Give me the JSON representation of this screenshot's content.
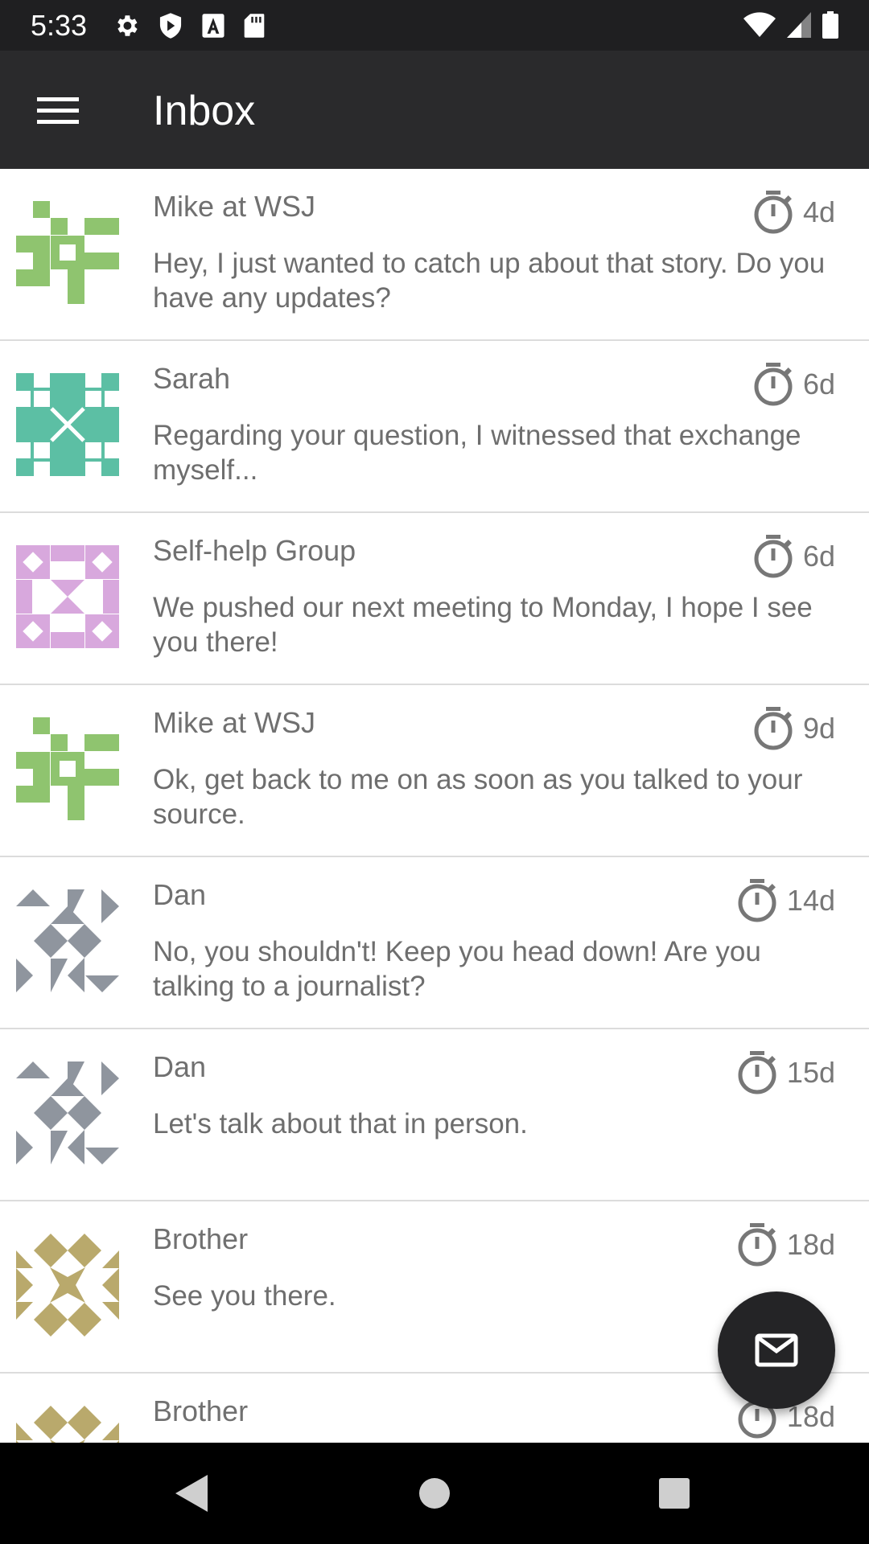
{
  "status_bar": {
    "time": "5:33",
    "left_icons": [
      "settings-icon",
      "shield-icon",
      "keyboard-a-icon",
      "sd-card-icon"
    ],
    "right_icons": [
      "wifi-icon",
      "signal-icon",
      "battery-icon"
    ]
  },
  "app_bar": {
    "title": "Inbox",
    "menu_icon": "hamburger-menu-icon"
  },
  "messages": [
    {
      "sender": "Mike at WSJ",
      "preview": "Hey, I just wanted to catch up about that story. Do you have any updates?",
      "age": "4d",
      "avatar_color": "#8fc46f"
    },
    {
      "sender": "Sarah",
      "preview": "Regarding your question, I witnessed that exchange myself...",
      "age": "6d",
      "avatar_color": "#5cbfa4"
    },
    {
      "sender": "Self-help Group",
      "preview": "We pushed our next meeting to Monday, I hope I see you there!",
      "age": "6d",
      "avatar_color": "#d8a8dd"
    },
    {
      "sender": "Mike at WSJ",
      "preview": "Ok, get back to me on as soon as you talked to your source.",
      "age": "9d",
      "avatar_color": "#8fc46f"
    },
    {
      "sender": "Dan",
      "preview": "No, you shouldn't! Keep you head down! Are you talking to a journalist?",
      "age": "14d",
      "avatar_color": "#8f959e"
    },
    {
      "sender": "Dan",
      "preview": "Let's talk about that in person.",
      "age": "15d",
      "avatar_color": "#8f959e"
    },
    {
      "sender": "Brother",
      "preview": "See you there.",
      "age": "18d",
      "avatar_color": "#b9a96c"
    },
    {
      "sender": "Brother",
      "preview": "",
      "age": "18d",
      "avatar_color": "#b9a96c"
    }
  ],
  "fab": {
    "icon": "mail-icon"
  },
  "nav_bar": {
    "buttons": [
      "back-icon",
      "home-icon",
      "recents-icon"
    ]
  },
  "colors": {
    "status_bar": "#1f1f21",
    "app_bar": "#2a2a2c",
    "fab": "#242426",
    "text_primary": "#707070"
  }
}
